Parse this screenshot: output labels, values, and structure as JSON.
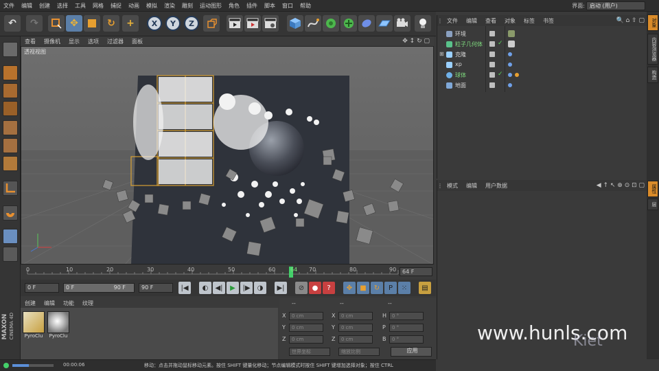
{
  "menubar": {
    "items": [
      "文件",
      "编辑",
      "创建",
      "选择",
      "工具",
      "网格",
      "捕捉",
      "动画",
      "模拟",
      "渲染",
      "雕刻",
      "运动图形",
      "角色",
      "插件",
      "脚本",
      "窗口",
      "帮助"
    ],
    "layout_label": "界面:",
    "layout_value": "启动 (用户)"
  },
  "toolbar": {
    "xyz": [
      "X",
      "Y",
      "Z"
    ]
  },
  "viewport": {
    "menu": [
      "查看",
      "摄像机",
      "显示",
      "选项",
      "过滤器",
      "面板"
    ],
    "label": "透视视图"
  },
  "timeline": {
    "ticks": [
      "0",
      "10",
      "20",
      "30",
      "40",
      "50",
      "60",
      "64",
      "70",
      "80",
      "90"
    ],
    "current_frame": "64 F",
    "playhead_fraction": 0.711
  },
  "transport": {
    "start_field": "0 F",
    "range_start": "0 F",
    "range_end": "90 F",
    "end_field": "90 F"
  },
  "materials": {
    "menu": [
      "创建",
      "编辑",
      "功能",
      "纹理"
    ],
    "items": [
      {
        "label": "PyroClu"
      },
      {
        "label": "PyroClu"
      }
    ]
  },
  "coords": {
    "headers": [
      "--",
      "--",
      "--"
    ],
    "rows": [
      {
        "a": "X",
        "av": "0 cm",
        "b": "X",
        "bv": "0 cm",
        "c": "H",
        "cv": "0 °"
      },
      {
        "a": "Y",
        "av": "0 cm",
        "b": "Y",
        "bv": "0 cm",
        "c": "P",
        "cv": "0 °"
      },
      {
        "a": "Z",
        "av": "0 cm",
        "b": "Z",
        "bv": "0 cm",
        "c": "B",
        "cv": "0 °"
      }
    ],
    "mode1": "世界坐标",
    "mode2": "缩放比例",
    "apply": "应用"
  },
  "status": {
    "time": "00:00:06",
    "message": "移动：点击并拖动鼠标移动元素。按住 SHIFT 键量化移动；节点编辑模式时按住 SHIFT 键增加选择对象；按住 CTRL"
  },
  "object_manager": {
    "menu": [
      "文件",
      "编辑",
      "查看",
      "对象",
      "标签",
      "书签"
    ],
    "objects": [
      {
        "name": "环境",
        "color": "#8aa0c0",
        "highlight": false
      },
      {
        "name": "粒子几何体",
        "color": "#59c28a",
        "highlight": true
      },
      {
        "name": "克隆",
        "color": "#9ad0ff",
        "highlight": false
      },
      {
        "name": "xp",
        "color": "#9ad0ff",
        "highlight": false
      },
      {
        "name": "球体",
        "color": "#6fb0e8",
        "highlight": true
      },
      {
        "name": "地面",
        "color": "#7fa8d8",
        "highlight": false
      }
    ]
  },
  "attribute_manager": {
    "menu": [
      "模式",
      "编辑",
      "用户数据"
    ]
  },
  "right_tabs": [
    "对象",
    "内容浏览器",
    "构造",
    "属性",
    "层"
  ],
  "watermark": "www.hunls.com",
  "brand": {
    "maxon": "MAXON",
    "cinema": "CINEMA 4D",
    "kiet": "Kiet"
  }
}
